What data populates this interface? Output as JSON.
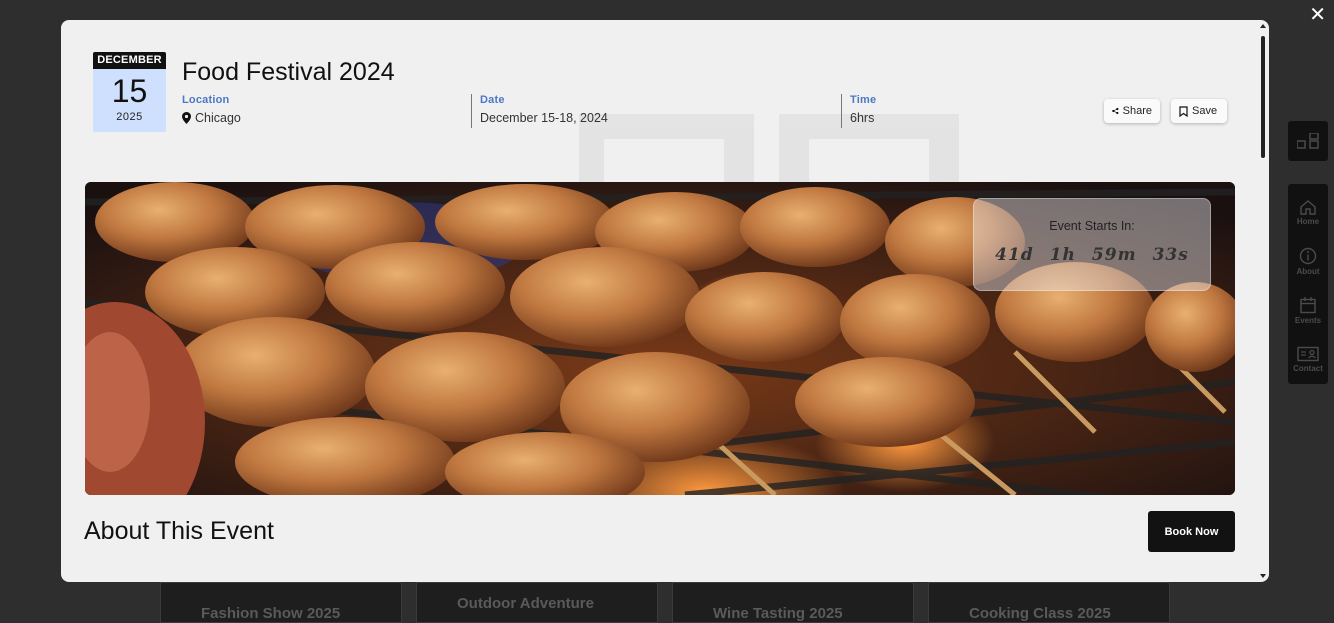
{
  "background": {
    "cards": [
      "Fashion Show 2025",
      "Outdoor Adventure",
      "Wine Tasting 2025",
      "Cooking Class 2025"
    ],
    "close_label": "✕"
  },
  "side_nav": {
    "items": [
      {
        "label": "Home",
        "icon": "home-icon"
      },
      {
        "label": "About",
        "icon": "info-icon"
      },
      {
        "label": "Events",
        "icon": "calendar-icon"
      },
      {
        "label": "Contact",
        "icon": "contact-card-icon"
      }
    ]
  },
  "event": {
    "date_badge": {
      "month": "DECEMBER",
      "day": "15",
      "year": "2025"
    },
    "title": "Food Festival 2024",
    "location": {
      "label": "Location",
      "value": "Chicago"
    },
    "date": {
      "label": "Date",
      "value": "December 15-18, 2024"
    },
    "time": {
      "label": "Time",
      "value": "6hrs"
    },
    "share_label": "Share",
    "save_label": "Save",
    "countdown": {
      "title": "Event Starts In:",
      "days": "41d",
      "hours": "1h",
      "minutes": "59m",
      "seconds": "33s"
    },
    "about_heading": "About This Event",
    "book_label": "Book Now"
  },
  "colors": {
    "accent_label": "#4e77c4",
    "date_badge_bg": "#cfe0ff",
    "button_dark": "#121212"
  }
}
